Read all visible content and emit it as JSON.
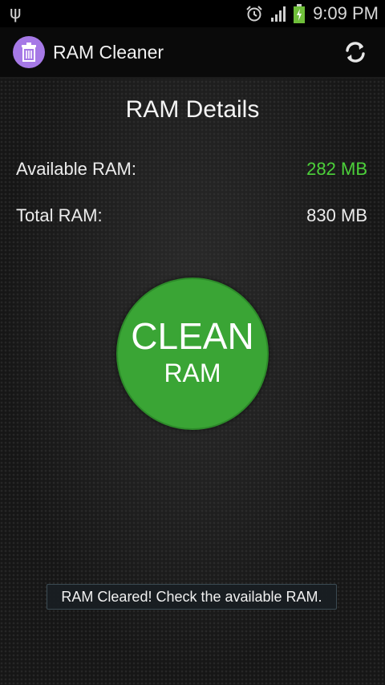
{
  "status_bar": {
    "time": "9:09 PM",
    "icons": [
      "usb-icon",
      "alarm-icon",
      "signal-icon",
      "battery-charging-icon"
    ]
  },
  "action_bar": {
    "title": "RAM Cleaner",
    "app_icon": "trash-icon",
    "refresh_icon": "refresh-icon"
  },
  "details": {
    "title": "RAM Details",
    "available_label": "Available RAM:",
    "available_value": "282 MB",
    "total_label": "Total RAM:",
    "total_value": "830 MB"
  },
  "clean_button": {
    "line1": "CLEAN",
    "line2": "RAM"
  },
  "toast": {
    "message": "RAM Cleared! Check the available RAM."
  },
  "colors": {
    "accent_green": "#3aa535",
    "available_value_color": "#4cd13a",
    "app_icon_purple": "#a679e6"
  }
}
